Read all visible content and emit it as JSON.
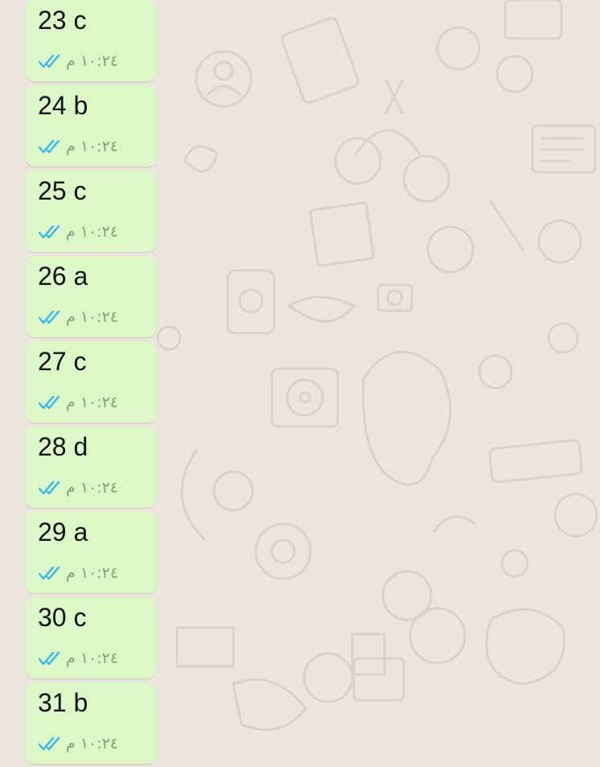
{
  "chat": {
    "messages": [
      {
        "text": "23 c",
        "time": "١٠:٢٤ م",
        "status_icon": "double-check-read-icon"
      },
      {
        "text": "24 b",
        "time": "١٠:٢٤ م",
        "status_icon": "double-check-read-icon"
      },
      {
        "text": "25 c",
        "time": "١٠:٢٤ م",
        "status_icon": "double-check-read-icon"
      },
      {
        "text": "26 a",
        "time": "١٠:٢٤ م",
        "status_icon": "double-check-read-icon"
      },
      {
        "text": "27 c",
        "time": "١٠:٢٤ م",
        "status_icon": "double-check-read-icon"
      },
      {
        "text": "28 d",
        "time": "١٠:٢٤ م",
        "status_icon": "double-check-read-icon"
      },
      {
        "text": "29 a",
        "time": "١٠:٢٤ م",
        "status_icon": "double-check-read-icon"
      },
      {
        "text": "30 c",
        "time": "١٠:٢٤ م",
        "status_icon": "double-check-read-icon"
      },
      {
        "text": "31 b",
        "time": "١٠:٢٤ م",
        "status_icon": "double-check-read-icon"
      }
    ]
  },
  "colors": {
    "wallpaper": "#ece5dd",
    "outgoing_bubble": "#dcf8c6",
    "read_tick": "#34b7f1",
    "timestamp": "#7fa07b"
  }
}
